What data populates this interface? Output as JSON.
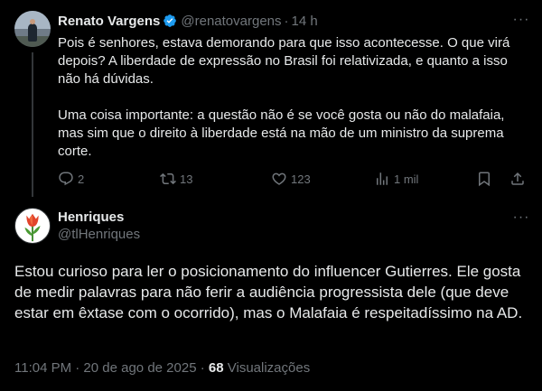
{
  "parent_tweet": {
    "author_name": "Renato Vargens",
    "handle": "@renatovargens",
    "separator": "·",
    "time": "14 h",
    "paragraph_1": "Pois é senhores, estava demorando para que isso acontecesse. O que virá depois? A liberdade de expressão no Brasil foi relativizada, e quanto a isso não há dúvidas.",
    "paragraph_2": "Uma coisa importante: a questão não é se você gosta ou não do malafaia, mas sim que o direito à liberdade está na mão de um ministro da suprema corte.",
    "more_icon": "···",
    "actions": {
      "replies": "2",
      "reposts": "13",
      "likes": "123",
      "views": "1 mil"
    }
  },
  "reply_tweet": {
    "author_name": "Henriques",
    "handle": "@tlHenriques",
    "more_icon": "···",
    "text": "Estou curioso para ler o posicionamento do influencer Gutierres. Ele gosta de medir palavras para não ferir a audiência progressista dele (que deve estar em êxtase com o ocorrido), mas o Malafaia é respeitadíssimo na AD.",
    "timestamp": "11:04 PM · 20 de ago de 2025",
    "meta_separator": "·",
    "views_count": "68",
    "views_label": "Visualizações"
  },
  "colors": {
    "background": "#000000",
    "text_primary": "#e7e9ea",
    "text_secondary": "#71767b",
    "verified_blue": "#1d9bf0",
    "divider": "#333639"
  },
  "icons": {
    "verified": "verified-badge-icon",
    "reply": "reply-bubble-icon",
    "retweet": "retweet-icon",
    "like": "heart-icon",
    "views": "views-bars-icon",
    "bookmark": "bookmark-icon",
    "share": "share-upload-icon",
    "henriques_avatar": "tulip-icon"
  }
}
